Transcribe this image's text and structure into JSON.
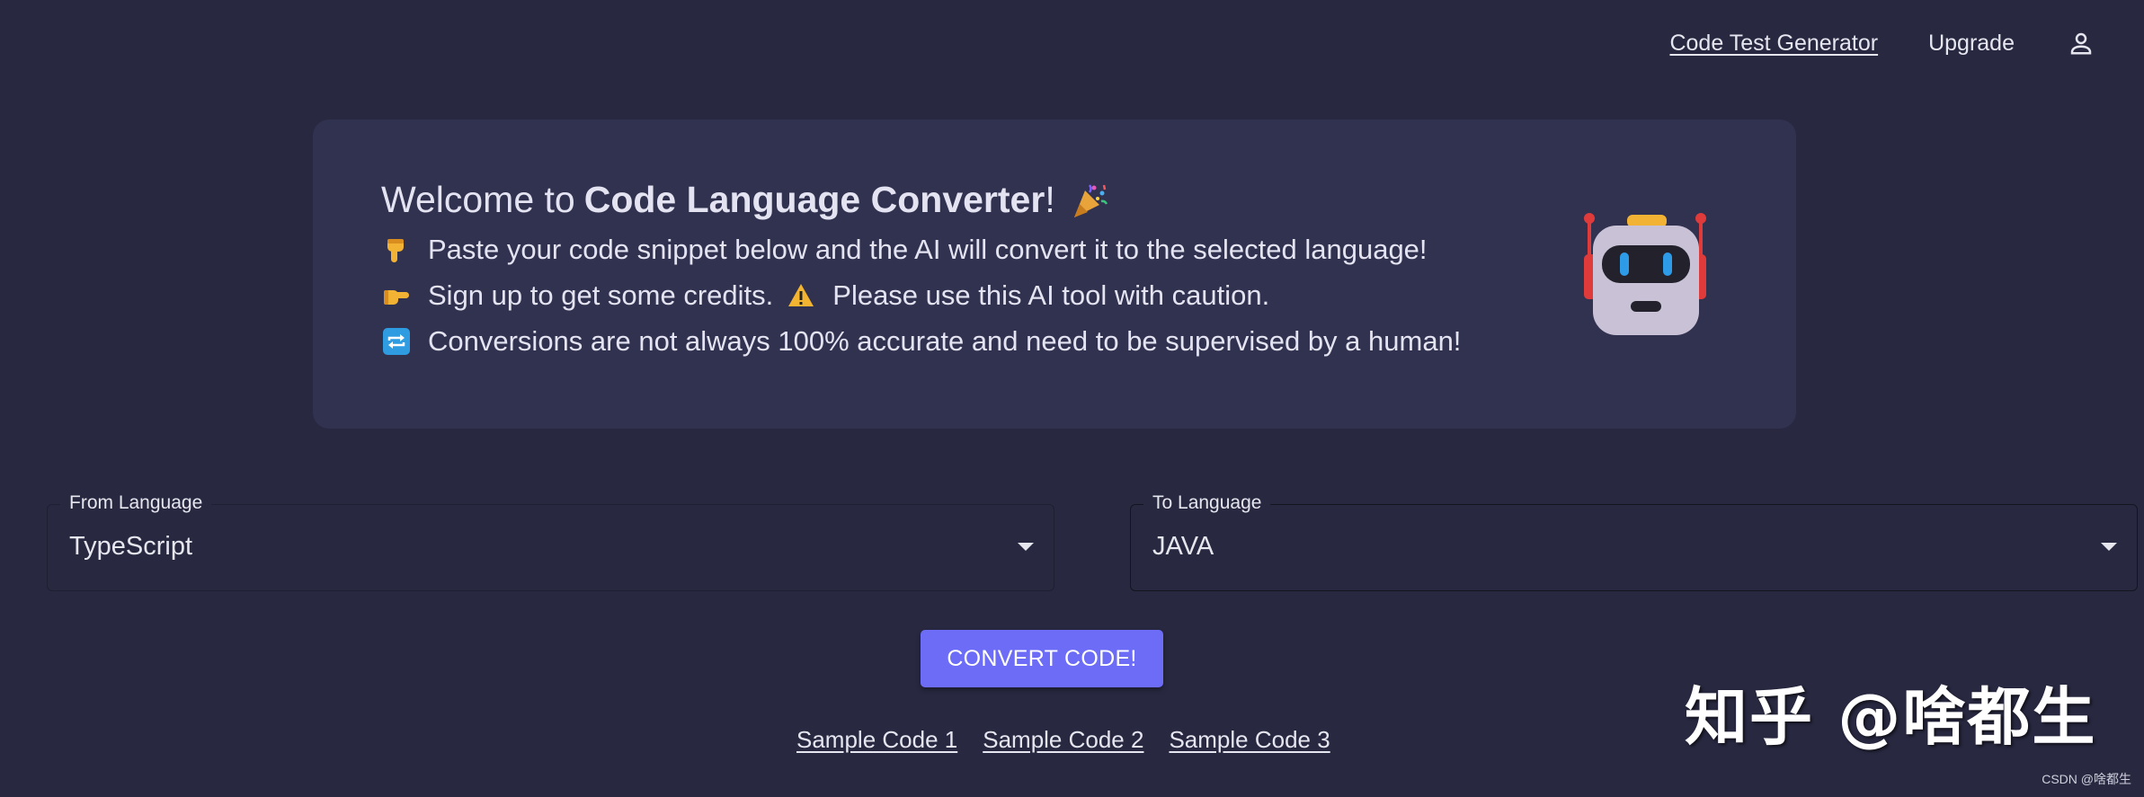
{
  "nav": {
    "code_test_generator": "Code Test Generator",
    "upgrade": "Upgrade",
    "account_icon": "user-icon"
  },
  "welcome": {
    "title_prefix": "Welcome to",
    "title_bold": "Code Language Converter",
    "title_suffix": "!",
    "lines": [
      {
        "icon": "pointing-down-hand",
        "text": "Paste your code snippet below and the AI will convert it to the selected language!"
      },
      {
        "icon": "pointing-right-hand",
        "text": "Sign up to get some credits.",
        "extra_icon": "warning-sign",
        "extra_text": "Please use this AI tool with caution."
      },
      {
        "icon": "repeat-arrows",
        "text": "Conversions are not always 100% accurate and need to be supervised by a human!"
      }
    ]
  },
  "from_language": {
    "label": "From Language",
    "value": "TypeScript"
  },
  "to_language": {
    "label": "To Language",
    "value": "JAVA"
  },
  "convert_button": "CONVERT CODE!",
  "samples": [
    "Sample Code 1",
    "Sample Code 2",
    "Sample Code 3"
  ],
  "watermark": "知乎 @啥都生",
  "csdn_mark": "CSDN @啥都生",
  "colors": {
    "background": "#282841",
    "card": "#313150",
    "accent": "#6c6cf6"
  }
}
